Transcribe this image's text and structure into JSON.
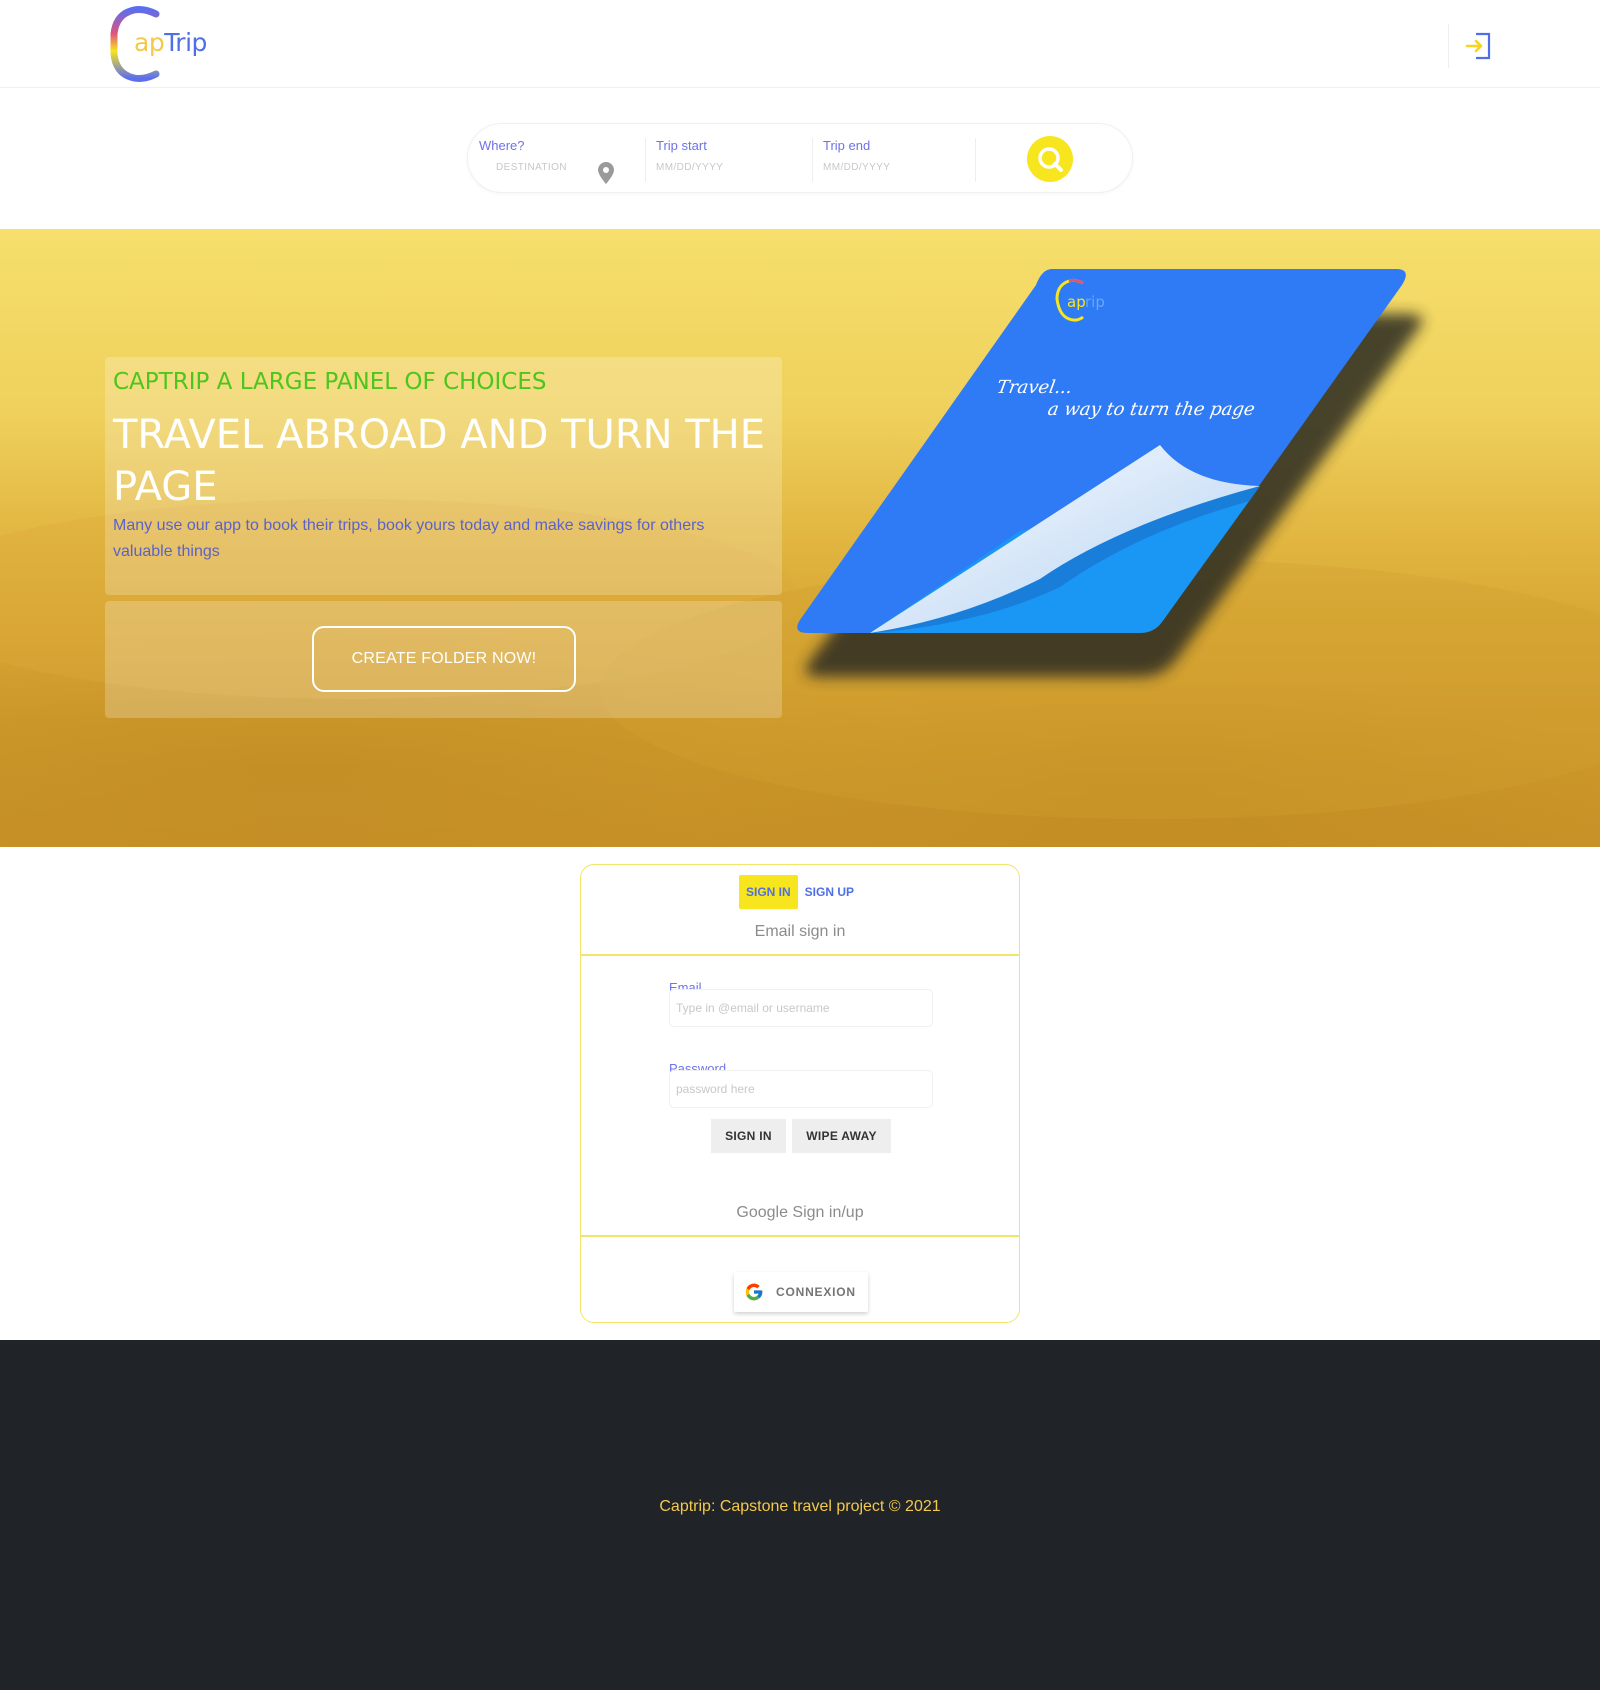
{
  "brand": {
    "logo_prefix": "ap",
    "logo_suffix": "Trip",
    "logo_letter": "C"
  },
  "header": {
    "login_icon": "sign-in-icon"
  },
  "search": {
    "where_label": "Where?",
    "where_placeholder": "DESTINATION",
    "start_label": "Trip start",
    "start_placeholder": "MM/DD/YYYY",
    "end_label": "Trip end",
    "end_placeholder": "MM/DD/YYYY",
    "button_icon": "search-icon"
  },
  "hero": {
    "eyebrow": "CAPTRIP A LARGE PANEL OF CHOICES",
    "headline": "TRAVEL ABROAD AND TURN THE PAGE",
    "lead": "Many use our app to book their trips, book yours today and make savings for others valuable things",
    "cta_label": "CREATE FOLDER NOW!",
    "book_slogan_1": "Travel...",
    "book_slogan_2": "a way to turn the page"
  },
  "auth": {
    "tab_signin": "SIGN IN",
    "tab_signup": "SIGN UP",
    "email_section_title": "Email sign in",
    "email_label": "Email",
    "email_placeholder": "Type in @email or username",
    "password_label": "Password",
    "password_placeholder": "password here",
    "signin_button": "SIGN IN",
    "wipe_button": "WIPE AWAY",
    "google_section_title": "Google Sign in/up",
    "google_button": "CONNEXION"
  },
  "footer": {
    "copyright": "Captrip: Capstone travel project © 2021"
  },
  "colors": {
    "accent_yellow": "#f7e51d",
    "brand_blue": "#4f6fe8",
    "book_blue": "#2f7bf5",
    "footer_bg": "#202328",
    "eyebrow_green": "#4ec51c"
  }
}
